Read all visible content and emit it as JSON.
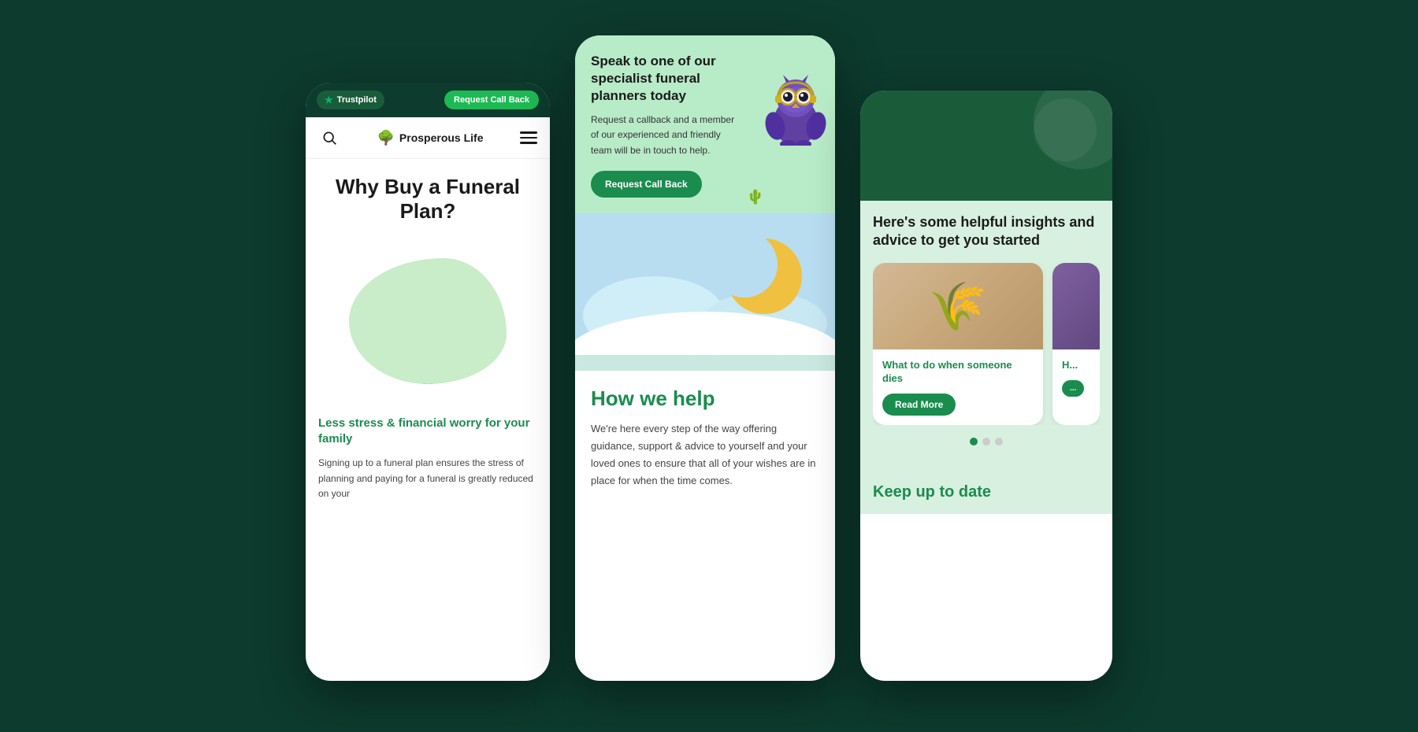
{
  "background_color": "#0d3b2e",
  "phone1": {
    "topbar": {
      "trustpilot_label": "Trustpilot",
      "callback_label": "Request Call Back"
    },
    "nav": {
      "brand_name": "Prosperous Life"
    },
    "headline": "Why Buy a Funeral Plan?",
    "subheadline": "Less stress & financial worry for your family",
    "body_text": "Signing up to a funeral plan ensures the stress of planning and paying for a funeral is greatly reduced on your"
  },
  "phone2": {
    "top_card": {
      "title": "Speak to one of our specialist funeral planners today",
      "description": "Request a callback and a member of our experienced and friendly team will be in touch to help.",
      "button_label": "Request Call Back"
    },
    "how_section": {
      "title": "How we help",
      "description": "We're here every step of the way offering guidance, support & advice to yourself and your loved ones to ensure that all of your wishes are in place for when the time comes."
    }
  },
  "phone3": {
    "insights_title": "Here's some helpful insights and advice to get you started",
    "article1": {
      "title": "What to do when someone dies",
      "read_more_label": "Read More"
    },
    "article2": {
      "title": "H..."
    },
    "dots": [
      "active",
      "inactive",
      "inactive"
    ],
    "keep_up_title": "Keep up to date"
  }
}
